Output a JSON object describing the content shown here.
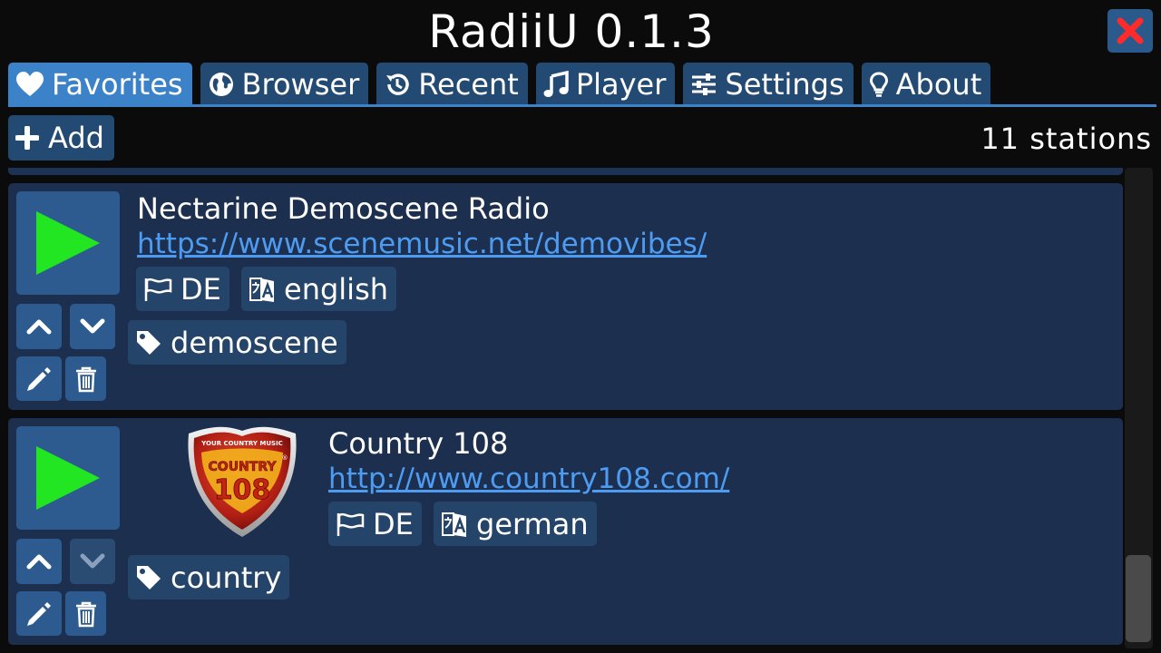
{
  "app": {
    "title": "RadiiU 0.1.3"
  },
  "tabs": [
    {
      "label": "Favorites",
      "icon": "heart-icon"
    },
    {
      "label": "Browser",
      "icon": "globe-icon"
    },
    {
      "label": "Recent",
      "icon": "history-icon"
    },
    {
      "label": "Player",
      "icon": "music-note-icon"
    },
    {
      "label": "Settings",
      "icon": "sliders-icon"
    },
    {
      "label": "About",
      "icon": "lightbulb-icon"
    }
  ],
  "toolbar": {
    "add_label": "Add",
    "station_count": "11 stations"
  },
  "stations": [
    {
      "name": "Nectarine Demoscene Radio",
      "url": "https://www.scenemusic.net/demovibes/",
      "country": "DE",
      "language": "english",
      "tag": "demoscene"
    },
    {
      "name": "Country 108",
      "url": "http://www.country108.com/",
      "country": "DE",
      "language": "german",
      "tag": "country",
      "logo": {
        "top_text": "YOUR COUNTRY MUSIC",
        "brand": "COUNTRY",
        "number": "108",
        "mark": "®"
      }
    }
  ],
  "colors": {
    "accent": "#3b82c8",
    "tab": "#234a73",
    "card": "#1c2f4f",
    "link": "#4d9cf2",
    "play": "#22e622",
    "close": "#ff2a2a"
  }
}
